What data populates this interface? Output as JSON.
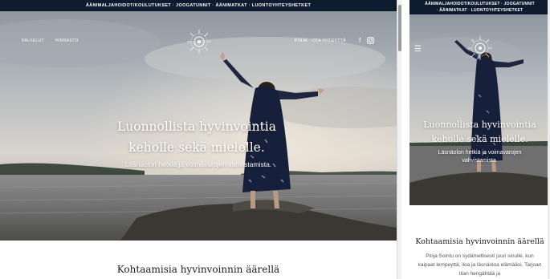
{
  "announcement": {
    "desktop": "ÄÄNIMALJAHOIDOT/KOULUTUKSET · JOOGATUNNIT · ÄÄNIMATKAT · LUONTOYHTEYSHETKET",
    "mobile_line1": "ÄÄNIMALJAHOIDOT/KOULUTUKSET · JOOGATUNNIT",
    "mobile_line2": "· ÄÄNIMATKAT · LUONTOYHTEYSHETKET"
  },
  "nav": {
    "left": [
      "PALVELUT",
      "HINNASTO"
    ],
    "right": [
      "PINJA",
      "OTA YHTEYTTÄ"
    ],
    "social_icons": [
      "facebook-icon",
      "instagram-icon"
    ]
  },
  "hero": {
    "heading_line1": "Luonnollista hyvinvointia",
    "heading_line2": "keholle sekä mielelle.",
    "subtext": "Läsnäolon hetkiä ja voimavarojen vahvistamista."
  },
  "section": {
    "title": "Kohtaamisia hyvinvoinnin äärellä",
    "body": "Pinja Sointu on sydämellisesti juuri sinulle, kun kaipaat lempeyttä, iloa ja läsnäoloa elämääsi. Tarjoan tilan hengähtää ja"
  },
  "colors": {
    "topbar": "#0e1a2e",
    "text_dark": "#1c1c1c",
    "hero_text": "#ffffff"
  }
}
